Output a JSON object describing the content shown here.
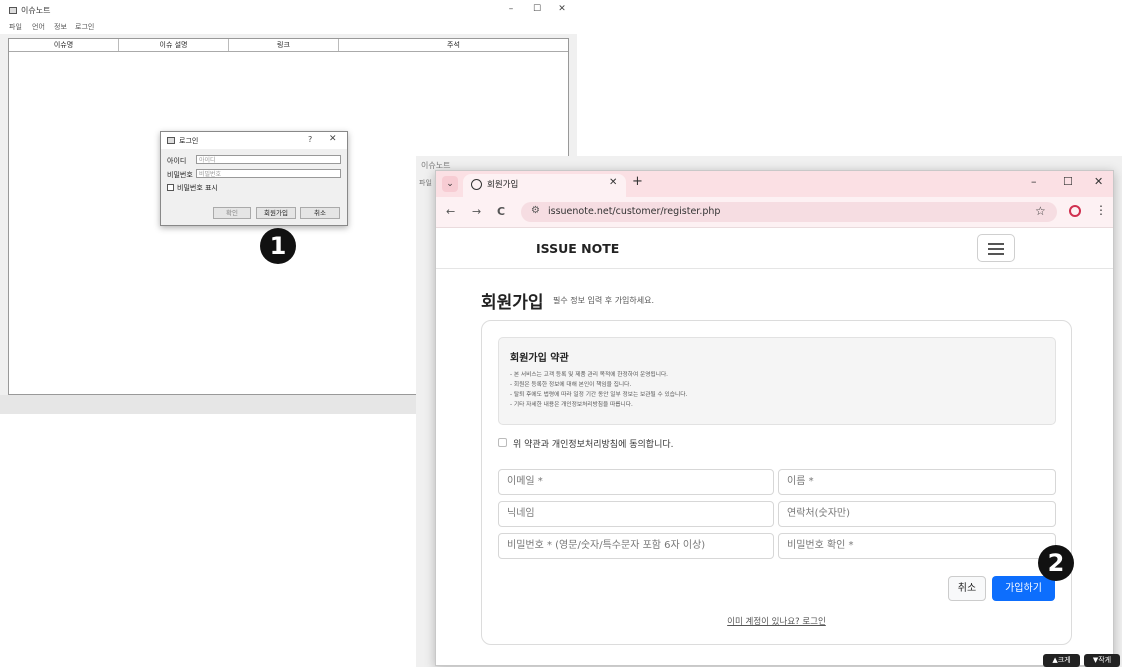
{
  "app_window": {
    "title": "이슈노트",
    "controls": {
      "minimize": "–",
      "maximize": "☐",
      "close": "✕"
    },
    "menu": [
      "파일",
      "언어",
      "정보",
      "로그인"
    ],
    "table_columns": [
      "이슈명",
      "이슈 설명",
      "링크",
      "주석"
    ]
  },
  "login_dialog": {
    "title": "로그인",
    "help": "?",
    "close": "✕",
    "id_label": "아이디",
    "id_placeholder": "아이디",
    "pw_label": "비밀번호",
    "pw_placeholder": "비밀번호",
    "show_pw_label": "비밀번호 표시",
    "ok_button": "확인",
    "register_button": "회원가입",
    "cancel_button": "취소"
  },
  "badges": {
    "one": "1",
    "two": "2"
  },
  "background_app": {
    "title": "이슈노트",
    "menu": "파일"
  },
  "browser": {
    "tab_title": "회원가입",
    "tab_close": "✕",
    "new_tab": "+",
    "tab_menu": "⌄",
    "window_controls": {
      "minimize": "–",
      "maximize": "☐",
      "close": "✕"
    },
    "nav": {
      "back": "←",
      "forward": "→",
      "reload": "C"
    },
    "url": "issuenote.net/customer/register.php",
    "bookmark_icon": "☆",
    "menu_icon": "⋮"
  },
  "page": {
    "brand": "ISSUE NOTE",
    "heading": "회원가입",
    "subheading": "필수 정보 입력 후 가입하세요.",
    "terms": {
      "title": "회원가입 약관",
      "lines": [
        "- 본 서비스는 고객 등록 및 제품 관리 목적에 한정하여 운영됩니다.",
        "- 회원은 등록한 정보에 대해 본인이 책임을 집니다.",
        "- 탈퇴 후에도 법령에 따라 일정 기간 동안 일부 정보는 보관될 수 있습니다.",
        "- 기타 자세한 내용은 개인정보처리방침을 따릅니다."
      ]
    },
    "agree_label": "위 약관과 개인정보처리방침에 동의합니다.",
    "fields": {
      "email": "이메일 *",
      "name": "이름 *",
      "nickname": "닉네임",
      "phone": "연락처(숫자만)",
      "password": "비밀번호 * (영문/숫자/특수문자 포함 6자 이상)",
      "password_confirm": "비밀번호 확인 *"
    },
    "cancel_button": "취소",
    "join_button": "가입하기",
    "login_link": "이미 계정이 있나요? 로그인"
  },
  "corner_buttons": {
    "bigger": "▲크게",
    "smaller": "▼작게"
  }
}
